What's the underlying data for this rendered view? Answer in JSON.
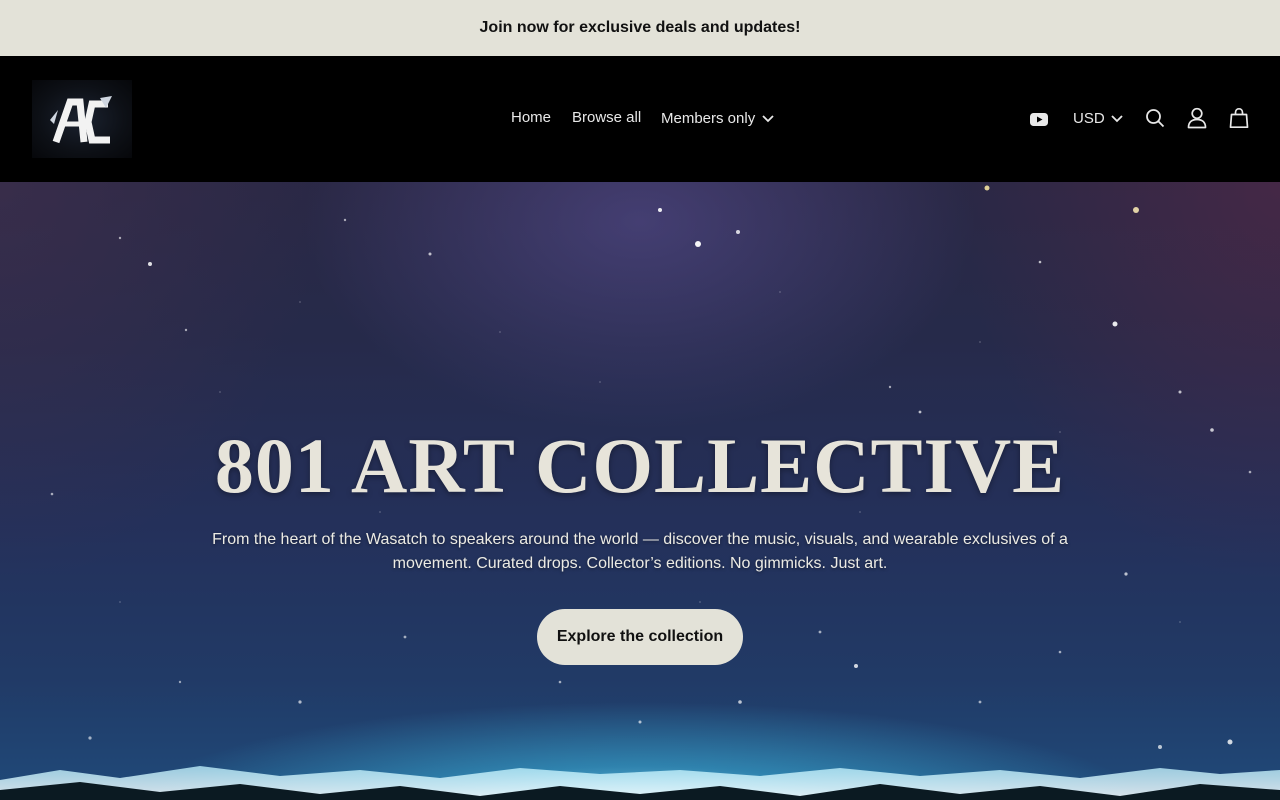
{
  "announcement": {
    "text": "Join now for exclusive deals and updates!"
  },
  "header": {
    "logo_text": "AC",
    "nav": {
      "home": "Home",
      "browse_all": "Browse all",
      "members_only": "Members only"
    },
    "currency": "USD",
    "icons": [
      "youtube-icon",
      "chevron-down-icon",
      "search-icon",
      "account-icon",
      "cart-icon"
    ]
  },
  "hero": {
    "title": "801 ART COLLECTIVE",
    "subtitle": "From the heart of the Wasatch to speakers around the world — discover the music, visuals, and wearable exclusives of a movement. Curated drops. Collector’s editions. No gimmicks. Just art.",
    "cta": "Explore the collection"
  },
  "colors": {
    "announcement_bg": "#e3e2d8",
    "header_bg": "#000000",
    "cta_bg": "#e3e2d8",
    "title_color": "#e7e4da"
  }
}
